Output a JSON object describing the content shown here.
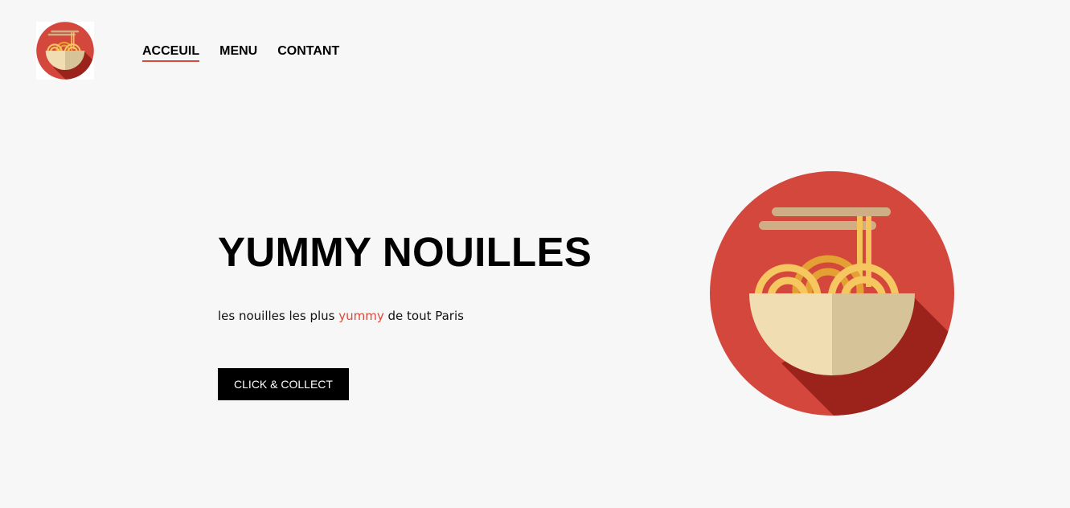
{
  "header": {
    "logo_icon": "noodle-bowl-icon",
    "nav": [
      {
        "label": "ACCEUIL",
        "active": true
      },
      {
        "label": "MENU",
        "active": false
      },
      {
        "label": "CONTANT",
        "active": false
      }
    ]
  },
  "hero": {
    "title": "YUMMY NOUILLES",
    "subtitle_before": "les nouilles les plus ",
    "subtitle_accent": "yummy",
    "subtitle_after": " de tout Paris",
    "cta_label": "CLICK & COLLECT",
    "illustration_icon": "noodle-bowl-icon"
  },
  "colors": {
    "accent": "#d9493c",
    "background": "#f7f7f7",
    "button": "#000000",
    "button_text": "#ffffff"
  }
}
